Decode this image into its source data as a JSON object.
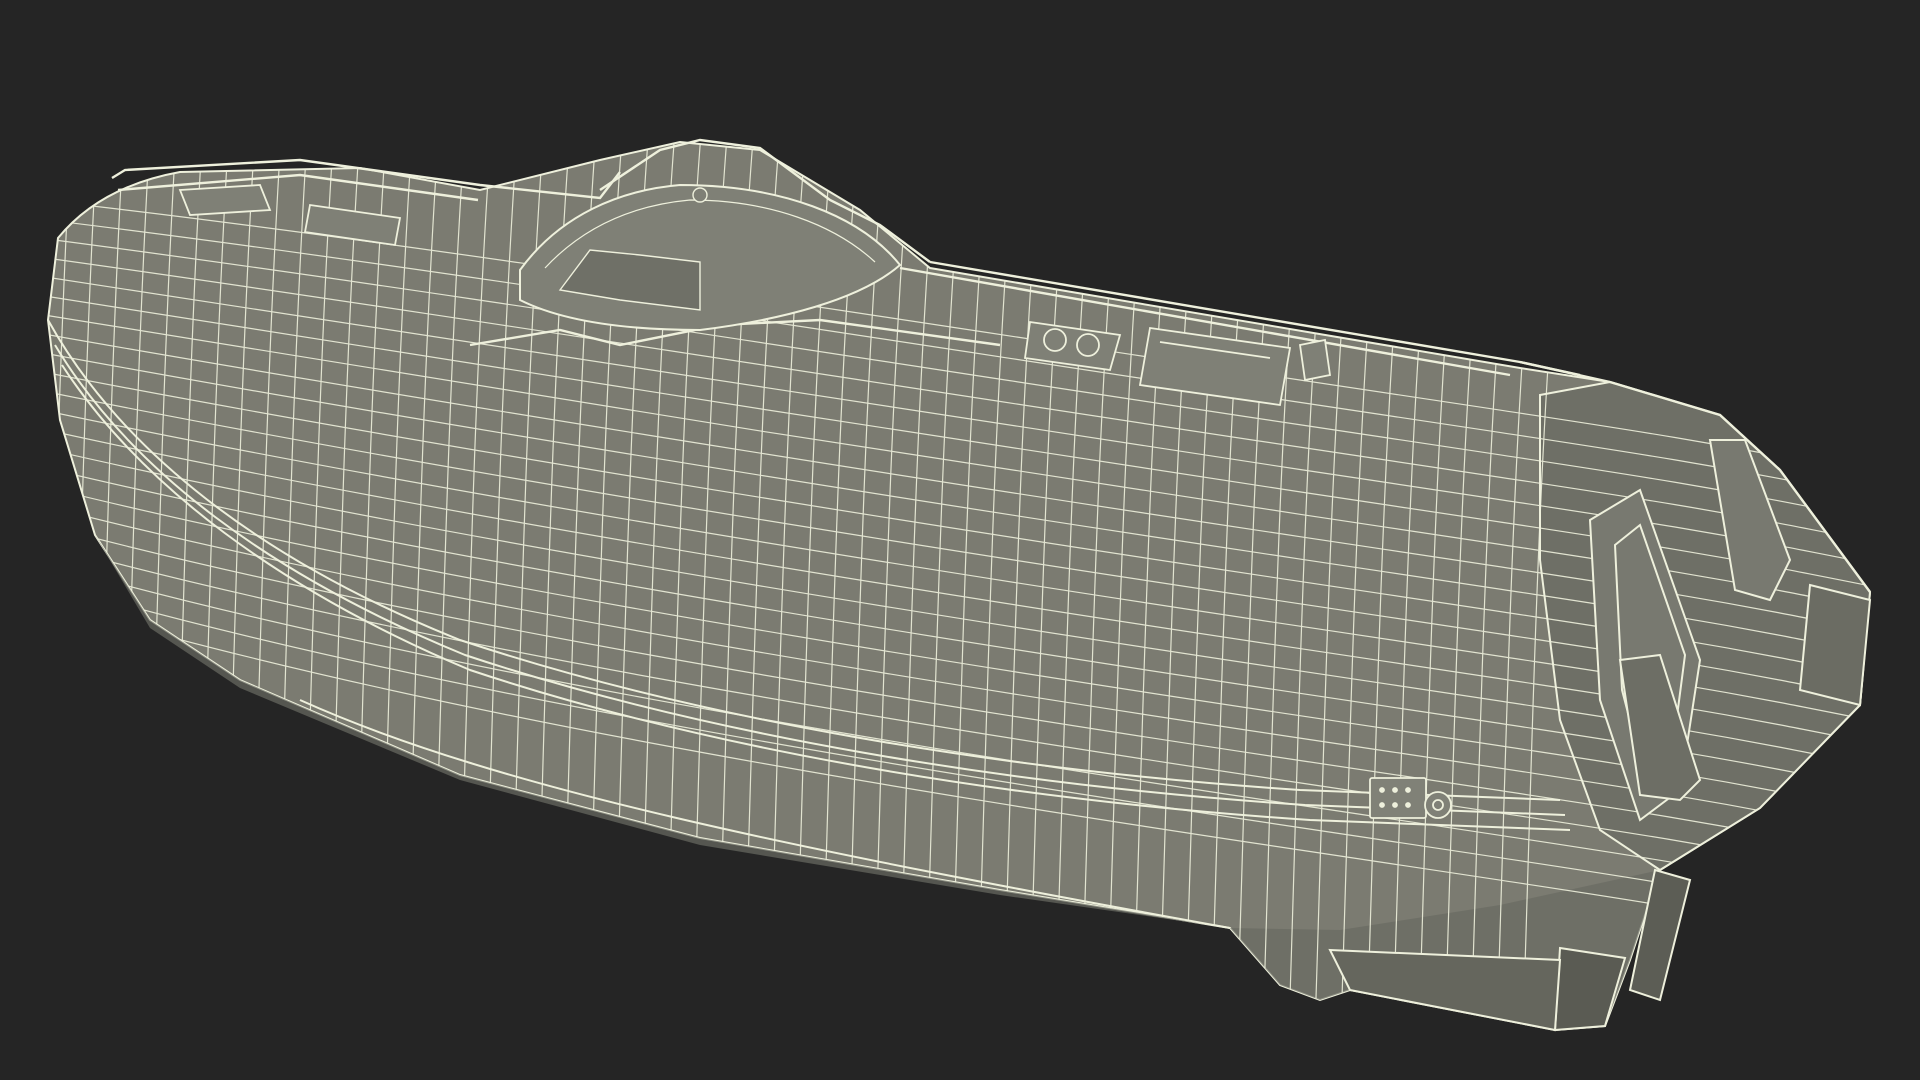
{
  "viewport": {
    "background_color": "#252525"
  },
  "model": {
    "subject": "boat-hull-wireframe",
    "surface_color": "#7b7b71",
    "surface_shade_color": "#63645b",
    "wire_color": "#eef0dc"
  }
}
